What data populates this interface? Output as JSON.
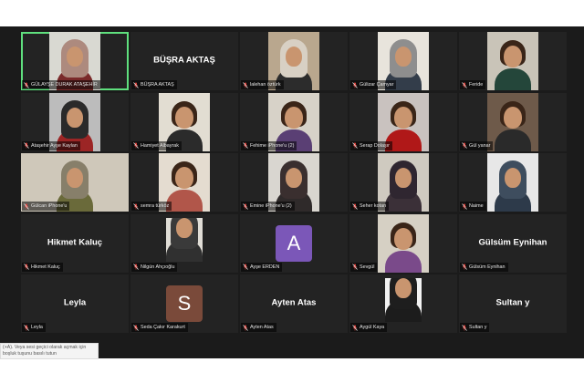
{
  "colors": {
    "background": "#1b1b1b",
    "tile": "#232323",
    "active_border": "#5fe07e",
    "mic_off": "#e0443e"
  },
  "participants": [
    {
      "label": "GÜLAYŞE DURAK ATAŞEHİR",
      "bg": "#d9d9d2",
      "body": "#7a2a2a",
      "scarf": "#ad8a7e",
      "active": true
    },
    {
      "label": "BÜŞRA AKTAŞ",
      "display_name": "BÜŞRA AKTAŞ"
    },
    {
      "label": "lalehan öztürk",
      "bg": "#b9a78e",
      "body": "#2c2c2c",
      "scarf": "#d8d0c4"
    },
    {
      "label": "Gülizar Çamyar",
      "bg": "#e8e4dc",
      "body": "#333d4a",
      "scarf": "#8e8e8e"
    },
    {
      "label": "Feride",
      "bg": "#c9c4b8",
      "body": "#24463a",
      "hair": true
    },
    {
      "label": "Ataşehir Ayşe Kaylan",
      "bg": "#bcbcbc",
      "body": "#9c2525",
      "scarf": "#2a2a2a"
    },
    {
      "label": "Hamiyet Albayrak",
      "bg": "#e2ddd2",
      "body": "#2b2b2b",
      "hair": true
    },
    {
      "label": "Fehime iPhone'u (2)",
      "bg": "#d7d2c8",
      "body": "#5a3f74",
      "hair": true
    },
    {
      "label": "Serap Dolaşır",
      "bg": "#c9c2bf",
      "body": "#b01818",
      "hair": true
    },
    {
      "label": "Gül yanar",
      "bg": "#6e5a4a",
      "body": "#2a2a2a",
      "hair": true
    },
    {
      "label": "Gülcan iPhone'u",
      "bg": "#cfc8ba",
      "body": "#6a6a3a",
      "scarf": "#877f6a",
      "wide": true
    },
    {
      "label": "semra türköz",
      "bg": "#e4dcd0",
      "body": "#b1564a",
      "hair": true
    },
    {
      "label": "Emine iPhone'u (2)",
      "bg": "#d9d6d0",
      "body": "#2f2a2a",
      "scarf": "#3a2f2f"
    },
    {
      "label": "Seher kotan",
      "bg": "#cfcac0",
      "body": "#3b3038",
      "scarf": "#2f2630"
    },
    {
      "label": "Naime",
      "bg": "#e7e7e7",
      "body": "#2d3a4a",
      "scarf": "#3e4d5e"
    },
    {
      "label": "Hikmet Kaluç",
      "display_name": "Hikmet Kaluç"
    },
    {
      "label": "Nilgün Ahçıoğlu",
      "bg": "#e0ddd6",
      "body": "#303030",
      "scarf": "#3a3a3a",
      "small": true
    },
    {
      "label": "Ayşe ERDEN",
      "avatar": "A",
      "avatar_color": "#7b57b8"
    },
    {
      "label": "Sevgül",
      "bg": "#d6d0c4",
      "body": "#7a4a8a",
      "hair": true
    },
    {
      "label": "Gülsüm Eynihan",
      "display_name": "Gülsüm Eynihan"
    },
    {
      "label": "Leyla",
      "display_name": "Leyla"
    },
    {
      "label": "Seda Çakır Karakurt",
      "avatar": "S",
      "avatar_color": "#7a4a3a"
    },
    {
      "label": "Ayten Atas",
      "display_name": "Ayten Atas"
    },
    {
      "label": "Aygül Kaya",
      "bg": "#f2f2f2",
      "body": "#1c1c1c",
      "scarf": "#1e1e1e",
      "small": true
    },
    {
      "label": "Sultan y",
      "display_name": "Sultan y"
    }
  ],
  "caption_text": "(+A). Veya sesi geçici olarak açmak için boşluk tuşunu basılı tutun"
}
